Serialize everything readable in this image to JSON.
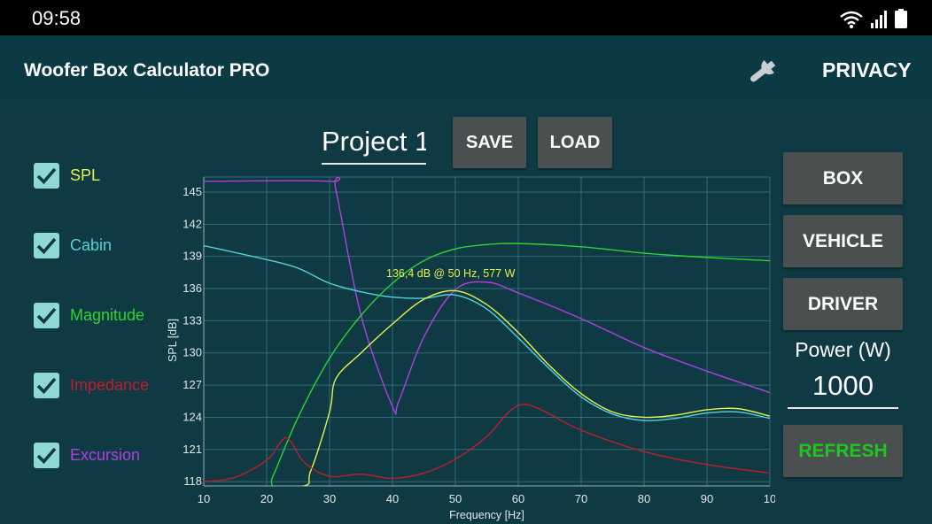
{
  "status": {
    "time": "09:58"
  },
  "appbar": {
    "title": "Woofer Box Calculator PRO",
    "privacy_label": "PRIVACY"
  },
  "project": {
    "name": "Project 1",
    "save_label": "SAVE",
    "load_label": "LOAD"
  },
  "checkboxes": [
    {
      "label": "SPL",
      "checked": true,
      "color": "#e4f24a"
    },
    {
      "label": "Cabin",
      "checked": true,
      "color": "#52d3db"
    },
    {
      "label": "Magnitude",
      "checked": true,
      "color": "#2bd432"
    },
    {
      "label": "Impedance",
      "checked": true,
      "color": "#c01f2a"
    },
    {
      "label": "Excursion",
      "checked": true,
      "color": "#b13ee3"
    }
  ],
  "side": {
    "box_label": "BOX",
    "vehicle_label": "VEHICLE",
    "driver_label": "DRIVER",
    "power_label": "Power (W)",
    "power_value": "1000",
    "refresh_label": "REFRESH"
  },
  "chart_data": {
    "type": "line",
    "xlabel": "Frequency [Hz]",
    "ylabel": "SPL [dB]",
    "xlim": [
      10,
      100
    ],
    "ylim": [
      117.6,
      146.4
    ],
    "x_ticks": [
      "10",
      "20",
      "30",
      "40",
      "50",
      "60",
      "70",
      "80",
      "90",
      "10"
    ],
    "y_ticks": [
      "118",
      "121",
      "124",
      "127",
      "130",
      "133",
      "136",
      "139",
      "142",
      "145"
    ],
    "grid": true,
    "annotation": {
      "text": "136,4 dB @ 50 Hz, 577 W",
      "x": 50,
      "y": 136.4
    },
    "colors": {
      "spl": "#e4f24a",
      "cabin": "#52d3db",
      "magnitude": "#2bd432",
      "impedance": "#c01f2a",
      "excursion": "#b13ee3",
      "grid": "#2f6e78",
      "axis_text": "#dfe8ea"
    },
    "series": [
      {
        "key": "excursion",
        "x": [
          10,
          30,
          31,
          35,
          40,
          41,
          45,
          50,
          55,
          60,
          70,
          80,
          90,
          100
        ],
        "y": [
          146.0,
          146.0,
          145.2,
          133.5,
          125.0,
          125.5,
          131.5,
          135.9,
          136.6,
          135.6,
          133.2,
          130.5,
          128.3,
          126.3
        ]
      },
      {
        "key": "cabin",
        "x": [
          10,
          20,
          25,
          30,
          35,
          40,
          45,
          50,
          55,
          60,
          65,
          70,
          75,
          80,
          85,
          90,
          95,
          100
        ],
        "y": [
          140.0,
          138.7,
          137.9,
          136.5,
          135.7,
          135.2,
          135.1,
          135.4,
          134.1,
          131.4,
          128.5,
          125.9,
          124.3,
          123.7,
          123.9,
          124.4,
          124.5,
          123.9
        ]
      },
      {
        "key": "magnitude",
        "x": [
          10,
          20,
          21,
          25,
          30,
          35,
          40,
          45,
          50,
          55,
          60,
          70,
          80,
          90,
          100
        ],
        "y": [
          117.5,
          117.5,
          118.5,
          124.0,
          129.5,
          133.5,
          136.5,
          138.6,
          139.7,
          140.1,
          140.2,
          139.9,
          139.3,
          138.9,
          138.6
        ]
      },
      {
        "key": "spl",
        "x": [
          10,
          25,
          27,
          30,
          31,
          35,
          40,
          45,
          50,
          55,
          60,
          65,
          70,
          75,
          80,
          85,
          90,
          95,
          100
        ],
        "y": [
          117.5,
          117.5,
          119.0,
          124.5,
          127.6,
          130.0,
          132.7,
          135.0,
          135.8,
          134.5,
          131.9,
          128.8,
          126.2,
          124.5,
          124.0,
          124.2,
          124.7,
          124.8,
          124.1
        ]
      },
      {
        "key": "impedance",
        "x": [
          10,
          15,
          20,
          22,
          23,
          24,
          26,
          30,
          35,
          40,
          45,
          50,
          55,
          58,
          60,
          62,
          65,
          70,
          80,
          90,
          100
        ],
        "y": [
          118.0,
          118.4,
          120.0,
          121.5,
          122.1,
          121.6,
          119.8,
          118.5,
          118.7,
          118.3,
          118.8,
          120.1,
          122.2,
          124.2,
          125.1,
          125.1,
          124.3,
          122.8,
          120.8,
          119.6,
          118.8
        ]
      }
    ]
  }
}
